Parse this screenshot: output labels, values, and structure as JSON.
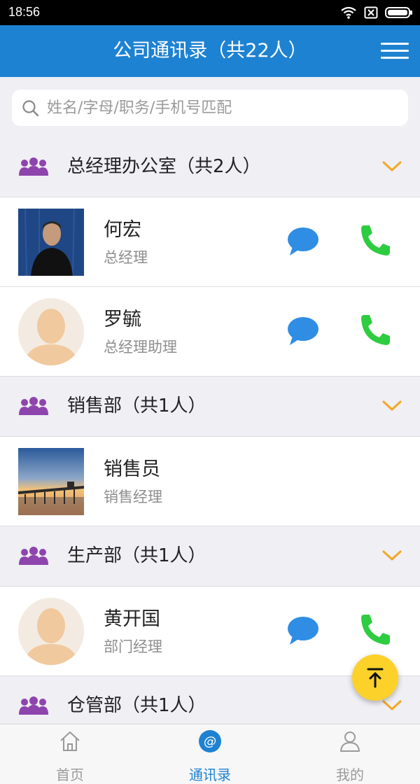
{
  "status_bar": {
    "time": "18:56"
  },
  "header": {
    "title": "公司通讯录（共22人）",
    "menu_icon": "hamburger-menu-icon"
  },
  "search": {
    "placeholder": "姓名/字母/职务/手机号匹配",
    "value": ""
  },
  "groups": [
    {
      "name": "总经理办公室（共2人）",
      "contacts": [
        {
          "name": "何宏",
          "role": "总经理",
          "avatar": "photo-man"
        },
        {
          "name": "罗毓",
          "role": "总经理助理",
          "avatar": "default-avatar"
        }
      ]
    },
    {
      "name": "销售部（共1人）",
      "contacts": [
        {
          "name": "销售员",
          "role": "销售经理",
          "avatar": "photo-pier-sunset"
        }
      ]
    },
    {
      "name": "生产部（共1人）",
      "contacts": [
        {
          "name": "黄开国",
          "role": "部门经理",
          "avatar": "default-avatar"
        }
      ]
    },
    {
      "name": "仓管部（共1人）",
      "contacts": []
    }
  ],
  "tabs": [
    {
      "label": "首页",
      "icon": "home-icon",
      "active": false
    },
    {
      "label": "通讯录",
      "icon": "contacts-at-icon",
      "active": true
    },
    {
      "label": "我的",
      "icon": "person-icon",
      "active": false
    }
  ],
  "colors": {
    "primary": "#1e82d2",
    "group_icon": "#8e44ad",
    "chevron": "#f5a623",
    "message": "#2f8de4",
    "call": "#2ecc40",
    "fab": "#fcd12a"
  }
}
